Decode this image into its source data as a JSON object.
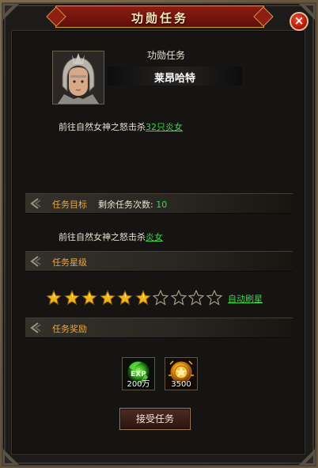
{
  "window": {
    "title": "功勋任务",
    "close_label": "×"
  },
  "npc": {
    "task_type_label": "功勋任务",
    "name": "莱昂哈特"
  },
  "description": {
    "prefix": "前往自然女神之怒击杀",
    "link_text": "32只炎女"
  },
  "objective": {
    "section_label": "任务目标",
    "remaining_label": "剩余任务次数:",
    "remaining_value": "10",
    "text_prefix": "前往自然女神之怒击杀",
    "link_text": "炎女"
  },
  "star_level": {
    "section_label": "任务星级",
    "filled_stars": 6,
    "total_stars": 10,
    "auto_refresh_label": "自动刷星"
  },
  "rewards": {
    "section_label": "任务奖励",
    "items": [
      {
        "icon": "exp-orb-icon",
        "value": "200万"
      },
      {
        "icon": "gold-medal-icon",
        "value": "3500"
      }
    ]
  },
  "accept_button": "接受任务",
  "colors": {
    "accent_green": "#3fd54a",
    "section_orange": "#e7a94a",
    "title_red": "#8e1d12",
    "star_gold": "#f2b61c"
  }
}
